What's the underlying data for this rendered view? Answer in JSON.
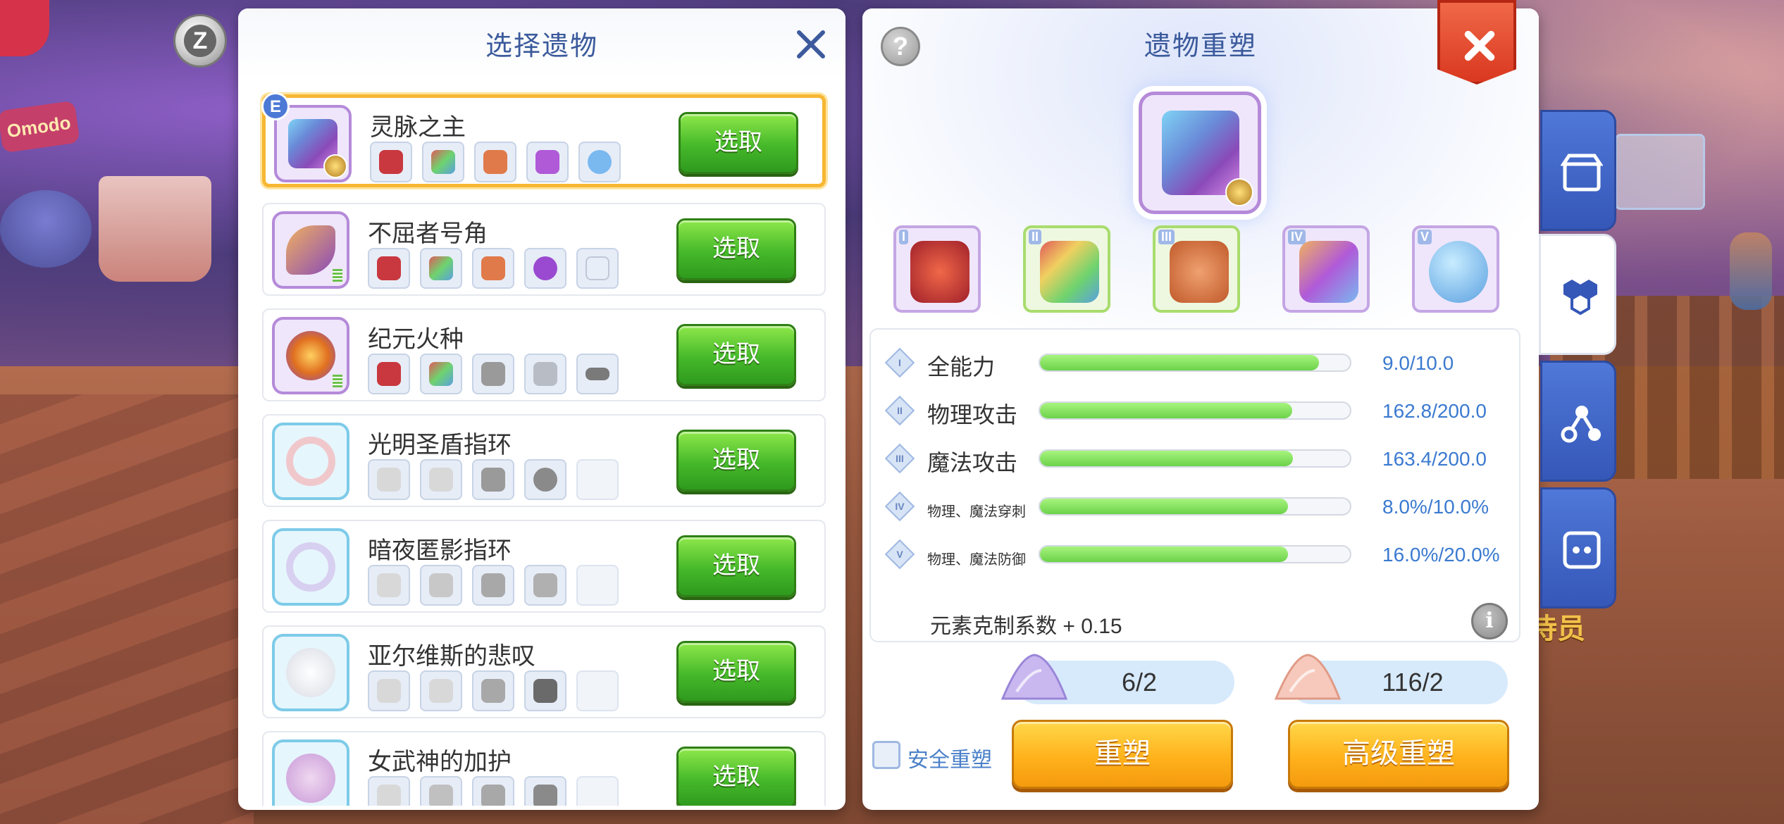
{
  "left_panel": {
    "title": "选择遗物",
    "items": [
      {
        "name": "灵脉之主",
        "selected": true,
        "badge": "E",
        "button": "选取"
      },
      {
        "name": "不屈者号角",
        "selected": false,
        "button": "选取"
      },
      {
        "name": "纪元火种",
        "selected": false,
        "button": "选取"
      },
      {
        "name": "光明圣盾指环",
        "selected": false,
        "button": "选取"
      },
      {
        "name": "暗夜匿影指环",
        "selected": false,
        "button": "选取"
      },
      {
        "name": "亚尔维斯的悲叹",
        "selected": false,
        "button": "选取"
      },
      {
        "name": "女武神的加护",
        "selected": false,
        "button": "选取"
      }
    ]
  },
  "right_panel": {
    "title": "遗物重塑",
    "help": "?",
    "gem_slots": [
      "I",
      "II",
      "III",
      "IV",
      "V"
    ],
    "stats": [
      {
        "roman": "I",
        "label": "全能力",
        "value": "9.0/10.0",
        "ratio": 0.9
      },
      {
        "roman": "II",
        "label": "物理攻击",
        "value": "162.8/200.0",
        "ratio": 0.814
      },
      {
        "roman": "III",
        "label": "魔法攻击",
        "value": "163.4/200.0",
        "ratio": 0.817
      },
      {
        "roman": "IV",
        "label": "物理、魔法穿刺",
        "value": "8.0%/10.0%",
        "ratio": 0.8
      },
      {
        "roman": "V",
        "label": "物理、魔法防御",
        "value": "16.0%/20.0%",
        "ratio": 0.8
      }
    ],
    "element_text": "元素克制系数 + 0.15",
    "info": "i",
    "costs": [
      "6/2",
      "116/2"
    ],
    "safe_label": "安全重塑",
    "buttons": {
      "reshape": "重塑",
      "advanced": "高级重塑"
    }
  },
  "z_badge": "Z",
  "background": {
    "sign_text": "Omodo",
    "bottom_right_text": "侍员"
  },
  "colors": {
    "title_blue": "#3b5a9c",
    "pick_green": "#45b82a",
    "reshape_orange": "#ffb21c",
    "select_highlight": "#f7b733",
    "close_red": "#d9381f",
    "tab_blue": "#3557b8"
  }
}
